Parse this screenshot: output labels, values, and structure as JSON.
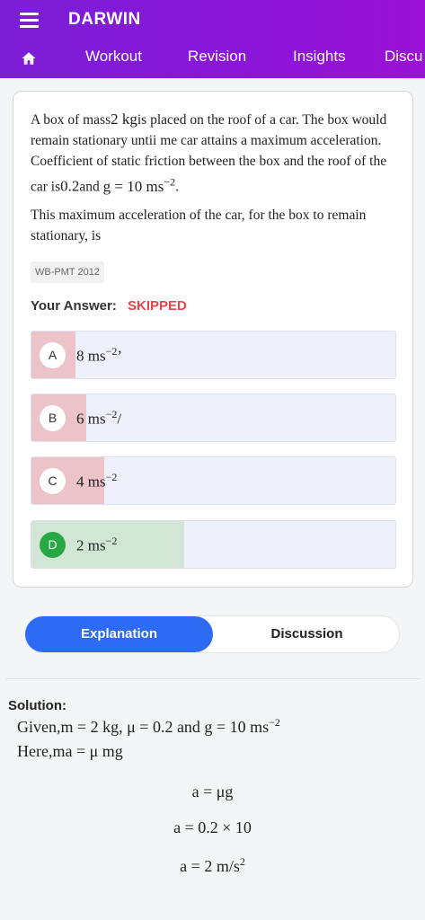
{
  "app": {
    "title": "DARWIN"
  },
  "nav": {
    "items": [
      "Workout",
      "Revision",
      "Insights",
      "Discu"
    ]
  },
  "question": {
    "part1": "A box of mass",
    "mass": "2 kg",
    "part2": "is placed on the roof of a car. The box would remain stationary untii me car attains a maximum acceleration. Coefficient of static friction between the box and the roof of the car is",
    "mu": "0.2",
    "part3": "and",
    "gvalue": "g = 10 ms",
    "gexp": "−2",
    "part4": ".",
    "para2": "This maximum acceleration of the car, for the box to remain stationary, is",
    "tag": "WB-PMT 2012"
  },
  "answer": {
    "label": "Your Answer:",
    "value": "SKIPPED"
  },
  "options": [
    {
      "letter": "A",
      "base": "8 ms",
      "exp": "−2",
      "suffix": "’",
      "percent": 12,
      "correct": false
    },
    {
      "letter": "B",
      "base": "6 ms",
      "exp": "−2",
      "suffix": "/",
      "percent": 15,
      "correct": false
    },
    {
      "letter": "C",
      "base": "4 ms",
      "exp": "−2",
      "suffix": "",
      "percent": 20,
      "correct": false
    },
    {
      "letter": "D",
      "base": "2 ms",
      "exp": "−2",
      "suffix": "",
      "percent": 42,
      "correct": true
    }
  ],
  "tabs": {
    "explanation": "Explanation",
    "discussion": "Discussion"
  },
  "solution": {
    "title": "Solution:",
    "line1": "Given,m = 2 kg,  μ = 0.2 and g = 10 ms",
    "line1_exp": "−2",
    "line2": "Here,ma  = μ mg",
    "eq1": "a = μg",
    "eq2": "a = 0.2 × 10",
    "eq3": "a = 2 m/s",
    "eq3_exp": "2"
  },
  "colors": {
    "header": "#8b15d8",
    "wrong_fill": "#ebc3c9",
    "correct_fill": "#d1e6d5",
    "correct_circle": "#27a844",
    "accent": "#2d6bf5",
    "skipped": "#e8454a"
  },
  "icons": {
    "menu": "hamburger-icon",
    "home": "home-icon"
  }
}
